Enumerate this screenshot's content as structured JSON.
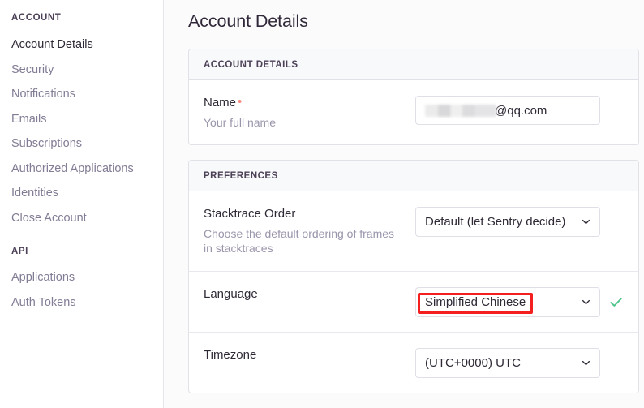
{
  "sidebar": {
    "sections": [
      {
        "heading": "ACCOUNT",
        "items": [
          {
            "label": "Account Details",
            "active": true
          },
          {
            "label": "Security",
            "active": false
          },
          {
            "label": "Notifications",
            "active": false
          },
          {
            "label": "Emails",
            "active": false
          },
          {
            "label": "Subscriptions",
            "active": false
          },
          {
            "label": "Authorized Applications",
            "active": false
          },
          {
            "label": "Identities",
            "active": false
          },
          {
            "label": "Close Account",
            "active": false
          }
        ]
      },
      {
        "heading": "API",
        "items": [
          {
            "label": "Applications",
            "active": false
          },
          {
            "label": "Auth Tokens",
            "active": false
          }
        ]
      }
    ]
  },
  "main": {
    "page_title": "Account Details",
    "panels": [
      {
        "header": "ACCOUNT DETAILS",
        "rows": [
          {
            "label": "Name",
            "required": true,
            "required_marker": "•",
            "help": "Your full name",
            "control": "text",
            "value_redacted": true,
            "value_suffix": "@qq.com"
          }
        ]
      },
      {
        "header": "PREFERENCES",
        "rows": [
          {
            "label": "Stacktrace Order",
            "required": false,
            "help": "Choose the default ordering of frames in stacktraces",
            "control": "select",
            "value": "Default (let Sentry decide)",
            "saved": false,
            "highlighted": false
          },
          {
            "label": "Language",
            "required": false,
            "help": "",
            "control": "select",
            "value": "Simplified Chinese",
            "saved": true,
            "highlighted": true
          },
          {
            "label": "Timezone",
            "required": false,
            "help": "",
            "control": "select",
            "value": "(UTC+0000) UTC",
            "saved": false,
            "highlighted": false
          }
        ]
      }
    ]
  },
  "icons": {
    "chevron_down": "chevron-down-icon",
    "check": "check-icon"
  },
  "colors": {
    "annotation_red": "#f41f1f",
    "success_green": "#4dc48a",
    "required_coral": "#f68b7f",
    "text_dark": "#2f2936",
    "text_muted": "#9b95ab",
    "panel_header_bg": "#f8f9fb",
    "border": "#e3e1e8",
    "main_bg": "#fbfbfc"
  }
}
